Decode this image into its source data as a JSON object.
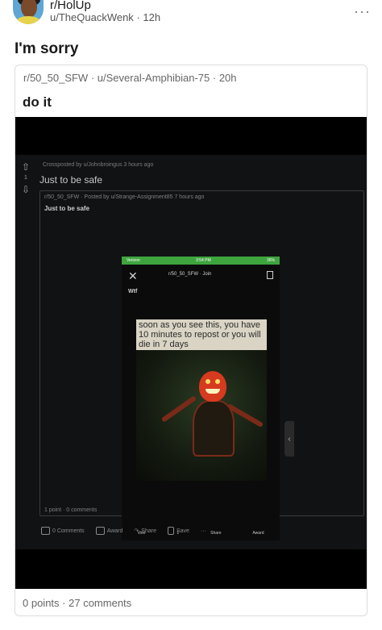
{
  "post": {
    "subreddit": "r/HolUp",
    "author": "u/TheQuackWenk",
    "age": "12h",
    "title": "I'm sorry",
    "more_label": "···"
  },
  "crosspost": {
    "subreddit": "r/50_50_SFW",
    "author": "u/Several-Amphibian-75",
    "age": "20h",
    "title": "do it",
    "points": "0 points",
    "comments": "27 comments"
  },
  "image": {
    "vote_count": "1",
    "xp_meta": "Crossposted by u/Johnbroingus 3 hours ago",
    "xp_title": "Just to be safe",
    "inner_meta": "r/50_50_SFW · Posted by u/Strange-Assignment85 7 hours ago",
    "inner_title": "Just to be safe",
    "inner_footer": "1 point · 0 comments",
    "actions": [
      "0 Comments",
      "Award",
      "Share",
      "Save",
      "···"
    ],
    "phone": {
      "status_left": "Verizon",
      "status_time": "3:54 PM",
      "status_right": "36%",
      "subreddit": "r/50_50_SFW · Join",
      "post_text": "Wtf",
      "caption": "soon as you see this, you have 10 minutes to repost or you will die in 7 days",
      "bar": [
        "Vote",
        "1",
        "Share",
        "Award"
      ]
    }
  },
  "colors": {
    "status_green": "#3ea43e",
    "figure_red": "#d63a1f"
  }
}
